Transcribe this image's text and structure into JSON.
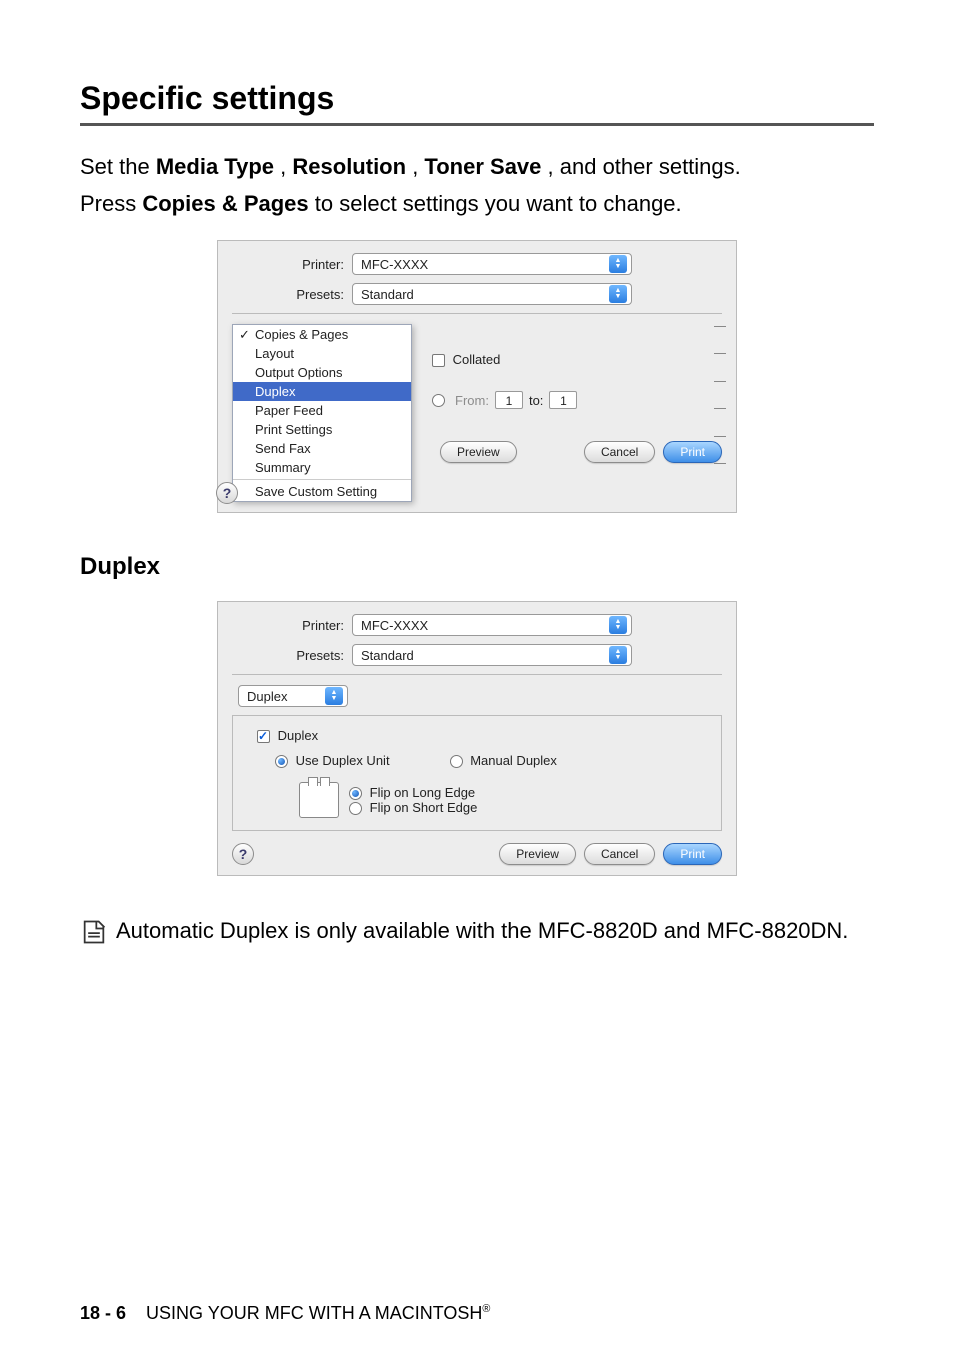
{
  "section": {
    "title": "Specific settings",
    "intro_parts": {
      "p1_pre": "Set the ",
      "b1": "Media Type",
      "comma1": ", ",
      "b2": "Resolution",
      "comma2": ", ",
      "b3": "Toner Save",
      "p1_post": ", and other settings.",
      "p2_pre": "Press ",
      "b4": "Copies & Pages",
      "p2_post": " to select settings you want to change."
    }
  },
  "dialog1": {
    "printer_label": "Printer:",
    "printer_value": "MFC-XXXX",
    "presets_label": "Presets:",
    "presets_value": "Standard",
    "menu": {
      "items": [
        "Copies & Pages",
        "Layout",
        "Output Options",
        "Duplex",
        "Paper Feed",
        "Print Settings",
        "Send Fax",
        "Summary"
      ],
      "save_custom": "Save Custom Setting"
    },
    "right_area": {
      "collated": "Collated",
      "from_label": "From:",
      "from_value": "1",
      "to_label": "to:",
      "to_value": "1"
    },
    "buttons": {
      "preview": "Preview",
      "cancel": "Cancel",
      "print": "Print"
    }
  },
  "subhead": "Duplex",
  "dialog2": {
    "printer_label": "Printer:",
    "printer_value": "MFC-XXXX",
    "presets_label": "Presets:",
    "presets_value": "Standard",
    "panel_select": "Duplex",
    "checkbox_label": "Duplex",
    "radio_use": "Use Duplex Unit",
    "radio_manual": "Manual Duplex",
    "radio_long": "Flip on Long Edge",
    "radio_short": "Flip on Short Edge",
    "buttons": {
      "preview": "Preview",
      "cancel": "Cancel",
      "print": "Print"
    }
  },
  "note_text": "Automatic Duplex is only available with the MFC-8820D and MFC-8820DN.",
  "footer": {
    "page": "18 - 6",
    "text": "USING YOUR MFC WITH A MACINTOSH",
    "reg": "®"
  }
}
